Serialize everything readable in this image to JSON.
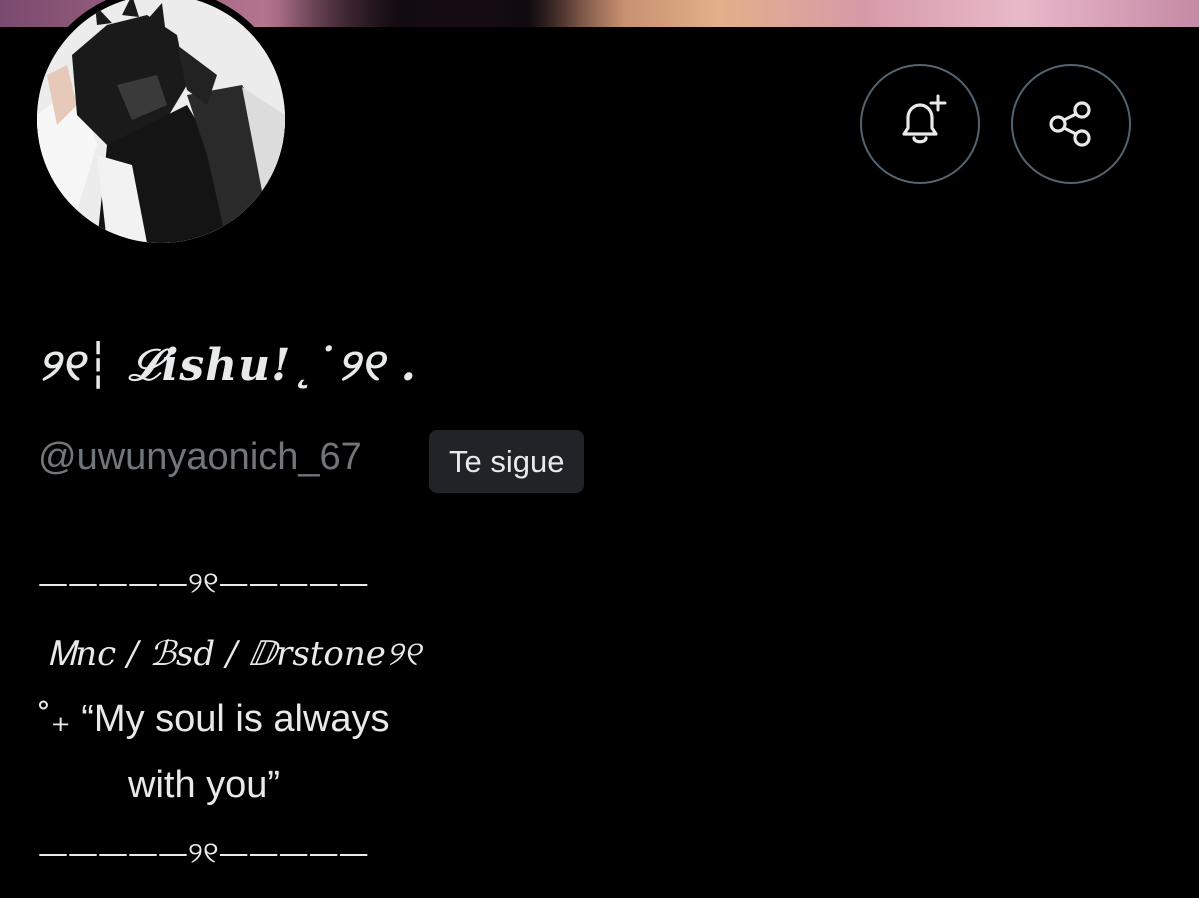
{
  "profile": {
    "display_name": "୨୧┆ ℒishu!˛˙୨୧ .",
    "handle": "@uwunyaonich_67",
    "follows_you_badge": "Te sigue"
  },
  "actions": {
    "notify_icon": "bell-plus-icon",
    "share_icon": "share-icon"
  },
  "bio": {
    "divider_top": "—————୨୧—————",
    "fandoms": "Ꮇnc / ℬsd / ⅅrstone୨୧",
    "quote_line1": "˚₊ “My soul is always",
    "quote_line2": "with you”",
    "divider_bottom": "—————୨୧—————"
  },
  "colors": {
    "background": "#000000",
    "primary_text": "#e7e9ea",
    "secondary_text": "#71767b",
    "button_border": "#536471",
    "badge_bg": "#202327"
  }
}
